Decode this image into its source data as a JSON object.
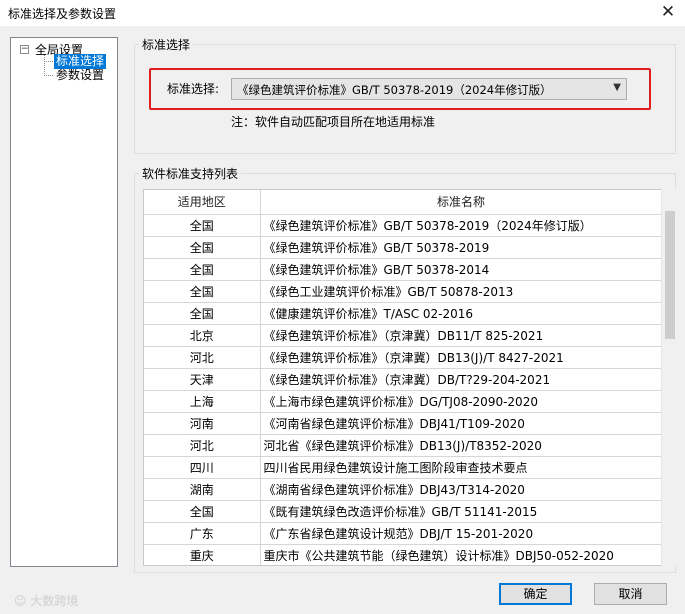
{
  "window": {
    "title": "标准选择及参数设置",
    "close_label": "✕"
  },
  "tree": {
    "toggle": "−",
    "root": "全局设置",
    "children": [
      "标准选择",
      "参数设置"
    ]
  },
  "standard_group": {
    "title": "标准选择",
    "label": "标准选择:",
    "selected": "《绿色建筑评价标准》GB/T 50378-2019（2024年修订版）",
    "note": "注：软件自动匹配项目所在地适用标准"
  },
  "list_group": {
    "title": "软件标准支持列表",
    "columns": [
      "适用地区",
      "标准名称"
    ],
    "rows": [
      [
        "全国",
        "《绿色建筑评价标准》GB/T 50378-2019（2024年修订版）"
      ],
      [
        "全国",
        "《绿色建筑评价标准》GB/T 50378-2019"
      ],
      [
        "全国",
        "《绿色建筑评价标准》GB/T 50378-2014"
      ],
      [
        "全国",
        "《绿色工业建筑评价标准》GB/T 50878-2013"
      ],
      [
        "全国",
        "《健康建筑评价标准》T/ASC 02-2016"
      ],
      [
        "北京",
        "《绿色建筑评价标准》（京津冀）DB11/T 825-2021"
      ],
      [
        "河北",
        "《绿色建筑评价标准》（京津冀）DB13(J)/T 8427-2021"
      ],
      [
        "天津",
        "《绿色建筑评价标准》（京津冀）DB/T?29-204-2021"
      ],
      [
        "上海",
        "《上海市绿色建筑评价标准》DG/TJ08-2090-2020"
      ],
      [
        "河南",
        "《河南省绿色建筑评价标准》DBJ41/T109-2020"
      ],
      [
        "河北",
        "河北省《绿色建筑评价标准》DB13(J)/T8352-2020"
      ],
      [
        "四川",
        "四川省民用绿色建筑设计施工图阶段审查技术要点"
      ],
      [
        "湖南",
        "《湖南省绿色建筑评价标准》DBJ43/T314-2020"
      ],
      [
        "全国",
        "《既有建筑绿色改造评价标准》GB/T 51141-2015"
      ],
      [
        "广东",
        "《广东省绿色建筑设计规范》DBJ/T 15-201-2020"
      ],
      [
        "重庆",
        "重庆市《公共建筑节能（绿色建筑）设计标准》DBJ50-052-2020"
      ],
      [
        "",
        ""
      ]
    ]
  },
  "buttons": {
    "ok": "确定",
    "cancel": "取消"
  },
  "watermark": "☺ 大数跨境"
}
